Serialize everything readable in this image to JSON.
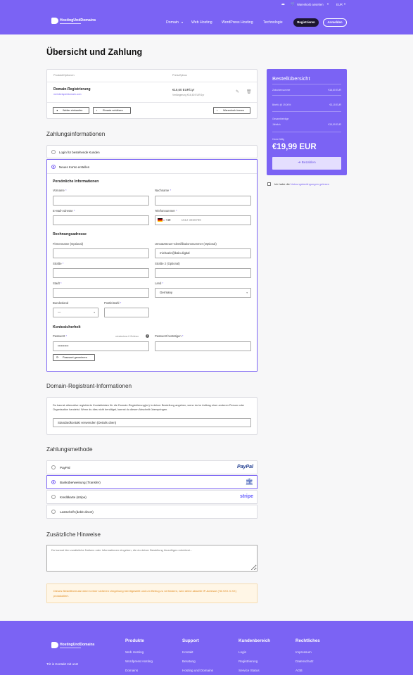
{
  "topbar": {
    "cart_label": "Warenkorb ansehen",
    "currency": "EUR"
  },
  "header": {
    "logo_text": "HostingUndDomains",
    "nav": [
      "Domain",
      "Web Hosting",
      "WordPress Hosting",
      "Technologie"
    ],
    "register_label": "Registrieren",
    "login_label": "Anmelden"
  },
  "page_title": "Übersicht und Zahlung",
  "cart_table": {
    "col_product": "Produkt/Optionen",
    "col_price": "Preis/Zyklus",
    "item_name": "Domain-Registrierung",
    "item_domain": "meinbeispieldomain.com",
    "item_price": "€16,60 EUR/1yr",
    "item_renewal": "Verlängerung €16,60 EUR/1yr",
    "continue_label": "Weiter einkaufen",
    "empty_label": "Einsatz schätzen",
    "clear_label": "Warenkorb leeren"
  },
  "summary": {
    "title": "Bestellübersicht",
    "rows": [
      {
        "label": "Zwischensumme",
        "value": "€16,60 EUR"
      },
      {
        "label": "Briefit. @ 19,00%",
        "value": "€3,15 EUR"
      }
    ],
    "recurring_label": "Gesamtbeträge",
    "recurring_cycle": "Jährlich",
    "recurring_value": "€19,99 EUR",
    "due_label": "Heute fällig",
    "total": "€19,99 EUR",
    "pay_label": "Bezahlen",
    "terms_prefix": "Ich habe die",
    "terms_link": "Nutzungsbedingungen gelesen"
  },
  "billing": {
    "heading": "Zahlungsinformationen",
    "login_option": "Login für bestehende Kunden",
    "new_option": "Neues Konto erstellen",
    "personal_heading": "Persönliche Informationen",
    "firstname_label": "Vorname",
    "lastname_label": "Nachname",
    "email_label": "E-Mail-Adresse",
    "phone_label": "Telefonnummer",
    "phone_code": "+49",
    "phone_placeholder": "1512 3456789",
    "address_heading": "Rechnungsadresse",
    "company_label": "Firmenname (Optional)",
    "vat_label": "Umsatzsteuer-Identifikationsnummer (Optional)",
    "vat_value": "michaelc@kalo.digital",
    "street_label": "Straße",
    "street2_label": "Straße 2 (Optional)",
    "city_label": "Stadt",
    "country_label": "Land",
    "country_value": "Germany",
    "state_label": "Bundesland",
    "state_value": "—",
    "zip_label": "Postleitzahl",
    "security_heading": "Kontosicherheit",
    "password_label": "Passwort",
    "password_hint": "mindestens 6 Zeichen",
    "password_value": "••••••••••",
    "password_confirm_label": "Passwort bestätigen",
    "generate_label": "Passwort generieren"
  },
  "registrant": {
    "heading": "Domain-Registrant-Informationen",
    "text": "Du kannst alternative registrierte Kontaktdaten für die Domain-Registrierung(en) in deiner Bestellung angeben, wenn du im Auftrag einer anderen Person oder Organisation handelst. Wenn du dies nicht benötigst, kannst du diesen Abschnitt überspringen.",
    "select_value": "Standardkontakt verwenden (Details oben)"
  },
  "payment": {
    "heading": "Zahlungsmethode",
    "methods": [
      {
        "label": "PayPal",
        "brand": "PayPal"
      },
      {
        "label": "Banküberweisung (Transfer)",
        "brand": "bank-icon"
      },
      {
        "label": "Kreditkarte (stripe)",
        "brand": "stripe"
      },
      {
        "label": "Lastschrift (debit direct)",
        "brand": ""
      }
    ],
    "selected": 1
  },
  "notes": {
    "heading": "Zusätzliche Hinweise",
    "placeholder": "Du kannst hier zusätzliche Notizen oder Informationen eingeben, die du deiner Bestellung hinzufügen möchtest..."
  },
  "notice": "Dieses Bestellformular wird in einer sicheren Umgebung bereitgestellt und um Betrug zu verhindern, wird deine aktuelle IP-Adresse (78.XXX.X.XX) protokolliert.",
  "footer": {
    "tagline": "Trit is Kontakt mit uns!",
    "columns": [
      {
        "title": "Produkte",
        "links": [
          "Web Hosting",
          "Wordpress Hosting",
          "Domains"
        ]
      },
      {
        "title": "Support",
        "links": [
          "Kontakt",
          "Beratung",
          "Hosting und Domains"
        ]
      },
      {
        "title": "Kundenbereich",
        "links": [
          "Login",
          "Registrierung",
          "Service Status"
        ]
      },
      {
        "title": "Rechtliches",
        "links": [
          "Impressum",
          "Datenschutz",
          "AGB"
        ]
      }
    ]
  },
  "colors": {
    "accent": "#7b63f4",
    "dark": "#1c1530",
    "notice_bg": "#fff6e6",
    "notice_text": "#e08a1e"
  }
}
